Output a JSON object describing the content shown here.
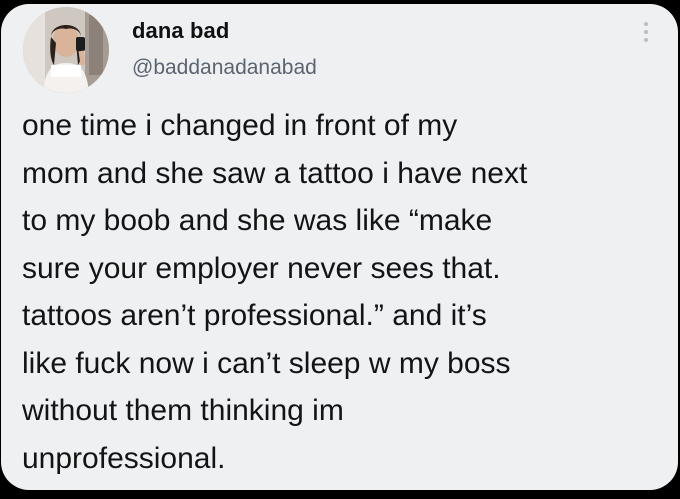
{
  "tweet": {
    "author": {
      "display_name": "dana bad",
      "handle": "@baddanadanabad",
      "avatar_icon": "profile-photo"
    },
    "menu_icon": "more-options-icon",
    "text_lines": [
      "one time i changed in front of my",
      "mom and she saw a tattoo i have next",
      "to my boob and she was like “make",
      "sure your employer never sees that.",
      "tattoos aren’t professional.” and it’s",
      "like fuck now i can’t sleep w my boss",
      "without them thinking im",
      "unprofessional."
    ]
  },
  "colors": {
    "background": "#000000",
    "card": "#eef0f2",
    "text": "#141414",
    "handle": "#5b6470"
  }
}
